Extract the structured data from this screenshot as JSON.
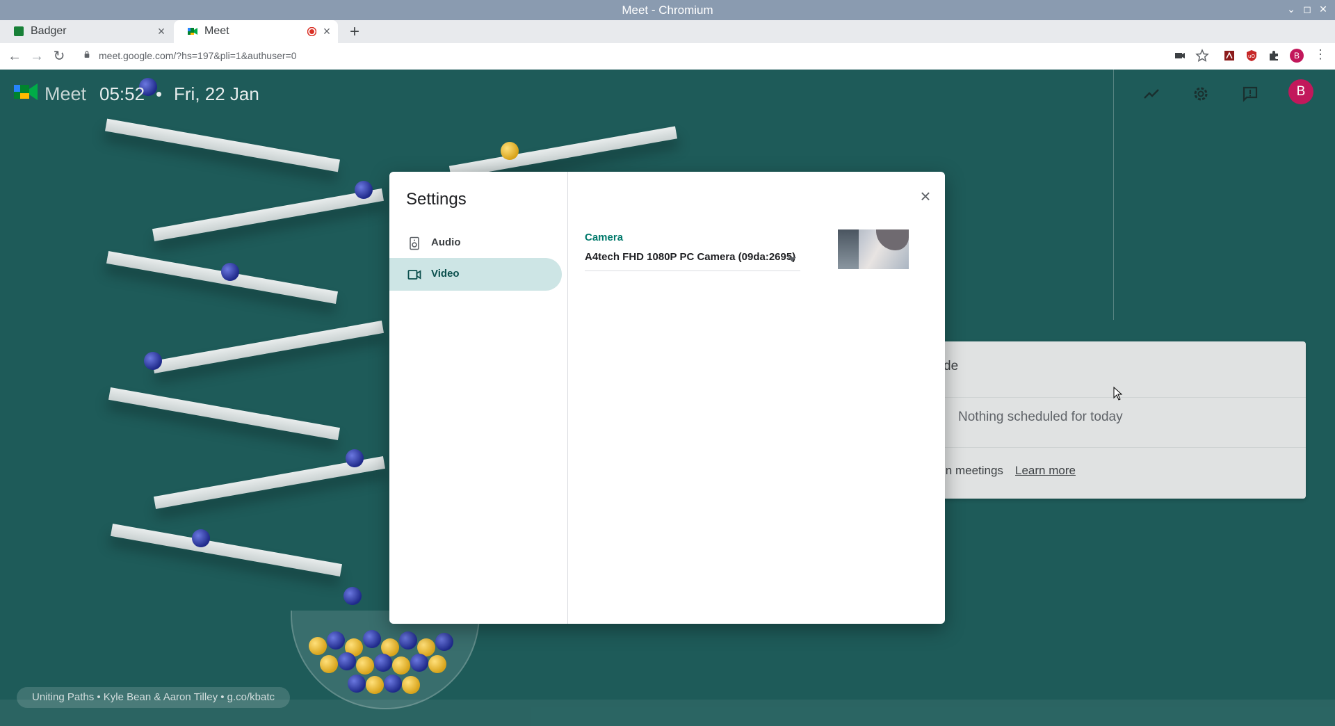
{
  "window": {
    "title": "Meet - Chromium",
    "controls": [
      "minimize-icon",
      "maximize-icon",
      "close-icon"
    ]
  },
  "tabs": [
    {
      "label": "Badger",
      "favicon": "sheets-icon",
      "active": false
    },
    {
      "label": "Meet",
      "favicon": "meet-icon",
      "active": true,
      "recording": true
    }
  ],
  "toolbar": {
    "url": "meet.google.com/?hs=197&pli=1&authuser=0",
    "profile_initial": "B"
  },
  "header": {
    "app_name": "Meet",
    "time": "05:52",
    "separator": "•",
    "date": "Fri, 22 Jan",
    "avatar_initial": "B",
    "icons": [
      "trending-icon",
      "settings-icon",
      "feedback-icon"
    ]
  },
  "card": {
    "title_fragment": "de",
    "schedule_text": "Nothing scheduled for today",
    "meetings_text": "in meetings",
    "learn_more": "Learn more"
  },
  "attribution": "Uniting Paths  •  Kyle Bean & Aaron Tilley  •  g.co/kbatc",
  "settings_dialog": {
    "title": "Settings",
    "nav": [
      {
        "label": "Audio",
        "icon": "speaker-icon",
        "selected": false
      },
      {
        "label": "Video",
        "icon": "videocam-icon",
        "selected": true
      }
    ],
    "camera_label": "Camera",
    "camera_value": "A4tech FHD 1080P PC Camera (09da:2695)"
  },
  "colors": {
    "accent": "#00796b",
    "selected_bg": "#cde5e5",
    "page_bg": "#1e5b59",
    "avatar": "#c2185b"
  }
}
